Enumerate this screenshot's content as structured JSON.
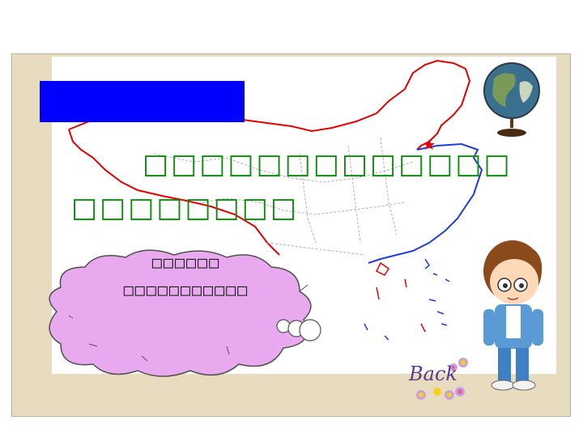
{
  "slide": {
    "heading_box_color": "#0000ff",
    "text_color": "#0f8a0f",
    "line1": "□□□□□□□□□□□□□",
    "line2": "□□□□□□□□",
    "bubble_line1": "□□□□□□",
    "bubble_line2": "□□□□□□□□□□□",
    "back_label": "Back",
    "icons": [
      "globe-icon",
      "china-map",
      "cartoon-boy",
      "flower-icon"
    ]
  }
}
